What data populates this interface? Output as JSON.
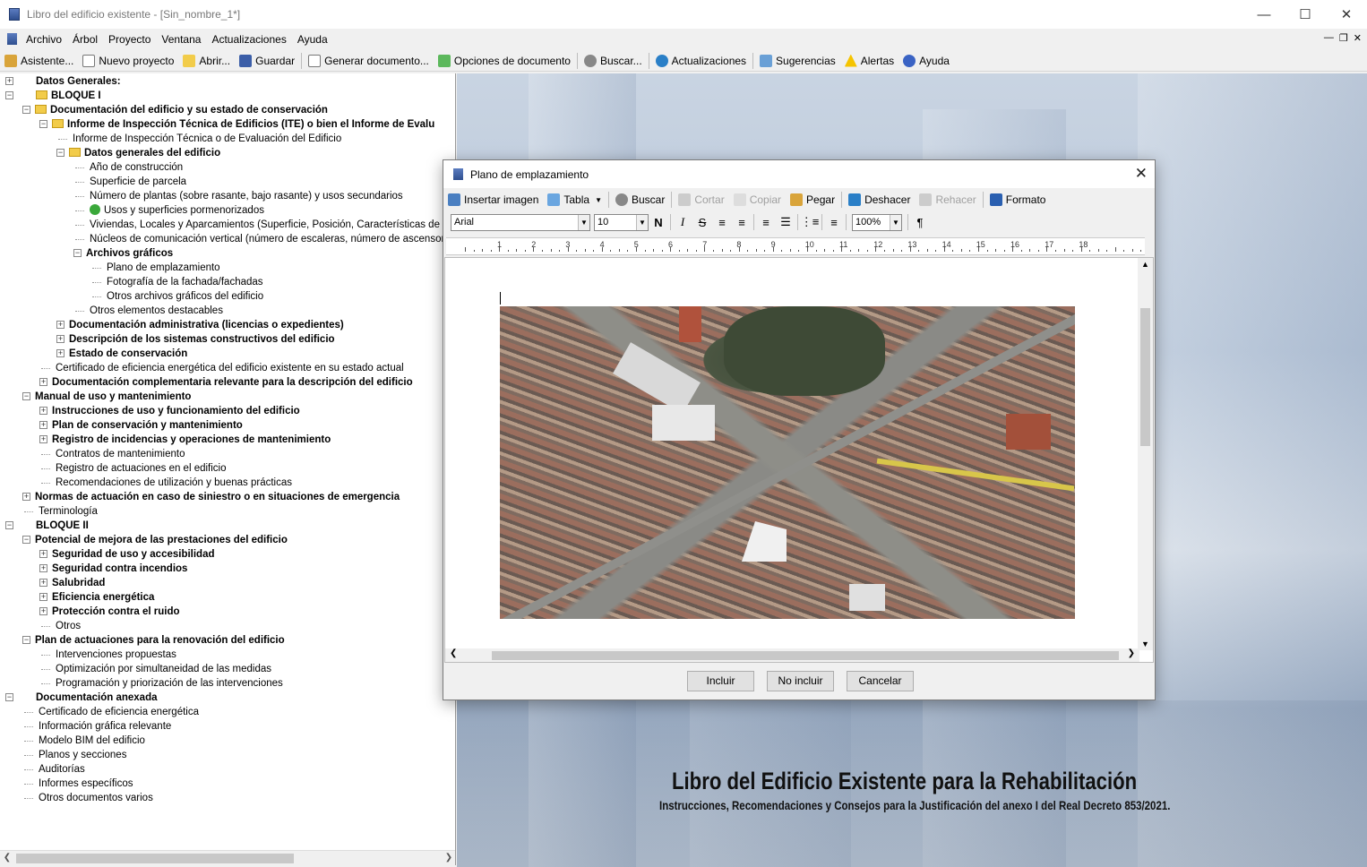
{
  "window": {
    "title": "Libro del edificio existente - [Sin_nombre_1*]"
  },
  "menu": [
    "Archivo",
    "Árbol",
    "Proyecto",
    "Ventana",
    "Actualizaciones",
    "Ayuda"
  ],
  "toolbar": {
    "asistente": "Asistente...",
    "nuevo": "Nuevo proyecto",
    "abrir": "Abrir...",
    "guardar": "Guardar",
    "generar": "Generar documento...",
    "opciones": "Opciones de documento",
    "buscar": "Buscar...",
    "actualizaciones": "Actualizaciones",
    "sugerencias": "Sugerencias",
    "alertas": "Alertas",
    "ayuda": "Ayuda"
  },
  "tree": [
    {
      "label": "Datos Generales:",
      "level": 0,
      "bold": true,
      "exp": "+"
    },
    {
      "label": "BLOQUE I",
      "level": 0,
      "bold": true,
      "exp": "-",
      "folder": true
    },
    {
      "label": "Documentación del edificio y su estado de conservación",
      "level": 1,
      "bold": true,
      "exp": "-",
      "folder": true
    },
    {
      "label": "Informe de Inspección Técnica de Edificios (ITE) o bien el Informe de Evalu",
      "level": 2,
      "bold": true,
      "exp": "-",
      "folder": true
    },
    {
      "label": "Informe de Inspección Técnica o de Evaluación del Edificio",
      "level": 3
    },
    {
      "label": "Datos generales del edificio",
      "level": 3,
      "bold": true,
      "exp": "-",
      "folder": true
    },
    {
      "label": "Año de construcción",
      "level": 4
    },
    {
      "label": "Superficie de parcela",
      "level": 4
    },
    {
      "label": "Número de plantas (sobre rasante, bajo rasante) y usos secundarios",
      "level": 4
    },
    {
      "label": "Usos y superficies pormenorizados",
      "level": 4,
      "check": true
    },
    {
      "label": "Viviendas, Locales y Aparcamientos (Superficie, Posición, Características de lo",
      "level": 4
    },
    {
      "label": "Núcleos de comunicación vertical (número de escaleras, número de ascensores",
      "level": 4
    },
    {
      "label": "Archivos gráficos",
      "level": 4,
      "bold": true,
      "exp": "-"
    },
    {
      "label": "Plano de emplazamiento",
      "level": 5
    },
    {
      "label": "Fotografía de la fachada/fachadas",
      "level": 5
    },
    {
      "label": "Otros archivos gráficos del edificio",
      "level": 5
    },
    {
      "label": "Otros elementos destacables",
      "level": 4
    },
    {
      "label": "Documentación administrativa (licencias o expedientes)",
      "level": 3,
      "bold": true,
      "exp": "+"
    },
    {
      "label": "Descripción de los sistemas constructivos del edificio",
      "level": 3,
      "bold": true,
      "exp": "+"
    },
    {
      "label": "Estado de conservación",
      "level": 3,
      "bold": true,
      "exp": "+"
    },
    {
      "label": "Certificado de eficiencia energética del edificio existente en su estado actual",
      "level": 2
    },
    {
      "label": "Documentación complementaria relevante para la descripción del edificio",
      "level": 2,
      "bold": true,
      "exp": "+"
    },
    {
      "label": "Manual de uso y mantenimiento",
      "level": 1,
      "bold": true,
      "exp": "-"
    },
    {
      "label": "Instrucciones de uso y funcionamiento del edificio",
      "level": 2,
      "bold": true,
      "exp": "+"
    },
    {
      "label": "Plan de conservación y mantenimiento",
      "level": 2,
      "bold": true,
      "exp": "+"
    },
    {
      "label": "Registro de incidencias y operaciones de mantenimiento",
      "level": 2,
      "bold": true,
      "exp": "+"
    },
    {
      "label": "Contratos de mantenimiento",
      "level": 2
    },
    {
      "label": "Registro de actuaciones en el edificio",
      "level": 2
    },
    {
      "label": "Recomendaciones de utilización y buenas prácticas",
      "level": 2
    },
    {
      "label": "Normas de actuación en caso de siniestro o en situaciones de emergencia",
      "level": 1,
      "bold": true,
      "exp": "+"
    },
    {
      "label": "Terminología",
      "level": 1
    },
    {
      "label": "BLOQUE II",
      "level": 0,
      "bold": true,
      "exp": "-"
    },
    {
      "label": "Potencial de mejora de las prestaciones del edificio",
      "level": 1,
      "bold": true,
      "exp": "-"
    },
    {
      "label": "Seguridad de uso y accesibilidad",
      "level": 2,
      "bold": true,
      "exp": "+"
    },
    {
      "label": "Seguridad contra incendios",
      "level": 2,
      "bold": true,
      "exp": "+"
    },
    {
      "label": "Salubridad",
      "level": 2,
      "bold": true,
      "exp": "+"
    },
    {
      "label": "Eficiencia energética",
      "level": 2,
      "bold": true,
      "exp": "+"
    },
    {
      "label": "Protección contra el ruido",
      "level": 2,
      "bold": true,
      "exp": "+"
    },
    {
      "label": "Otros",
      "level": 2
    },
    {
      "label": "Plan de actuaciones para la renovación del edificio",
      "level": 1,
      "bold": true,
      "exp": "-"
    },
    {
      "label": "Intervenciones propuestas",
      "level": 2
    },
    {
      "label": "Optimización por simultaneidad de las medidas",
      "level": 2
    },
    {
      "label": "Programación y priorización de las intervenciones",
      "level": 2
    },
    {
      "label": "Documentación anexada",
      "level": 0,
      "bold": true,
      "exp": "-"
    },
    {
      "label": "Certificado de eficiencia energética",
      "level": 1
    },
    {
      "label": "Información gráfica relevante",
      "level": 1
    },
    {
      "label": "Modelo BIM del edificio",
      "level": 1
    },
    {
      "label": "Planos y secciones",
      "level": 1
    },
    {
      "label": "Auditorías",
      "level": 1
    },
    {
      "label": "Informes específicos",
      "level": 1
    },
    {
      "label": "Otros documentos varios",
      "level": 1
    }
  ],
  "background": {
    "title": "Libro del Edificio Existente para la Rehabilitación",
    "subtitle": "Instrucciones, Recomendaciones y Consejos para la Justificación del anexo I del Real Decreto 853/2021."
  },
  "dialog": {
    "title": "Plano de emplazamiento",
    "toolbar": {
      "insertar": "Insertar imagen",
      "tabla": "Tabla",
      "buscar": "Buscar",
      "cortar": "Cortar",
      "copiar": "Copiar",
      "pegar": "Pegar",
      "deshacer": "Deshacer",
      "rehacer": "Rehacer",
      "formato": "Formato"
    },
    "font": "Arial",
    "size": "10",
    "zoom": "100%",
    "format": {
      "bold": "N",
      "italic": "I",
      "strike": "S",
      "para": "¶"
    },
    "ruler": [
      "1",
      "2",
      "3",
      "4",
      "5",
      "6",
      "7",
      "8",
      "9",
      "10",
      "11",
      "12",
      "13",
      "14",
      "15",
      "16",
      "17",
      "18"
    ],
    "buttons": {
      "incluir": "Incluir",
      "noincluir": "No incluir",
      "cancelar": "Cancelar"
    }
  },
  "colors": {
    "folder": "#f2cc4a",
    "check": "#3aa83a"
  }
}
